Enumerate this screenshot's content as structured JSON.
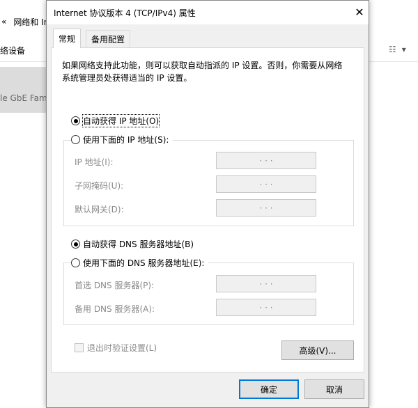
{
  "background": {
    "address_chevron": "«",
    "address_text": "网络和 Int",
    "toolbar_text": "络设备",
    "item_text": "le GbE Fam"
  },
  "dialog": {
    "title": "Internet 协议版本 4 (TCP/IPv4) 属性",
    "close": "✕",
    "tabs": [
      {
        "label": "常规"
      },
      {
        "label": "备用配置"
      }
    ],
    "description": "如果网络支持此功能，则可以获取自动指派的 IP 设置。否则，你需要从网络系统管理员处获得适当的 IP 设置。",
    "ip": {
      "auto_label": "自动获得 IP 地址(O)",
      "manual_label": "使用下面的 IP 地址(S):",
      "auto_selected": true,
      "fields": [
        {
          "label": "IP 地址(I):",
          "dots": "·   ·   ·"
        },
        {
          "label": "子网掩码(U):",
          "dots": "·   ·   ·"
        },
        {
          "label": "默认网关(D):",
          "dots": "·   ·   ·"
        }
      ]
    },
    "dns": {
      "auto_label": "自动获得 DNS 服务器地址(B)",
      "manual_label": "使用下面的 DNS 服务器地址(E):",
      "auto_selected": true,
      "fields": [
        {
          "label": "首选 DNS 服务器(P):",
          "dots": "·   ·   ·"
        },
        {
          "label": "备用 DNS 服务器(A):",
          "dots": "·   ·   ·"
        }
      ]
    },
    "validate_label": "退出时验证设置(L)",
    "advanced_button": "高级(V)...",
    "ok_button": "确定",
    "cancel_button": "取消"
  }
}
